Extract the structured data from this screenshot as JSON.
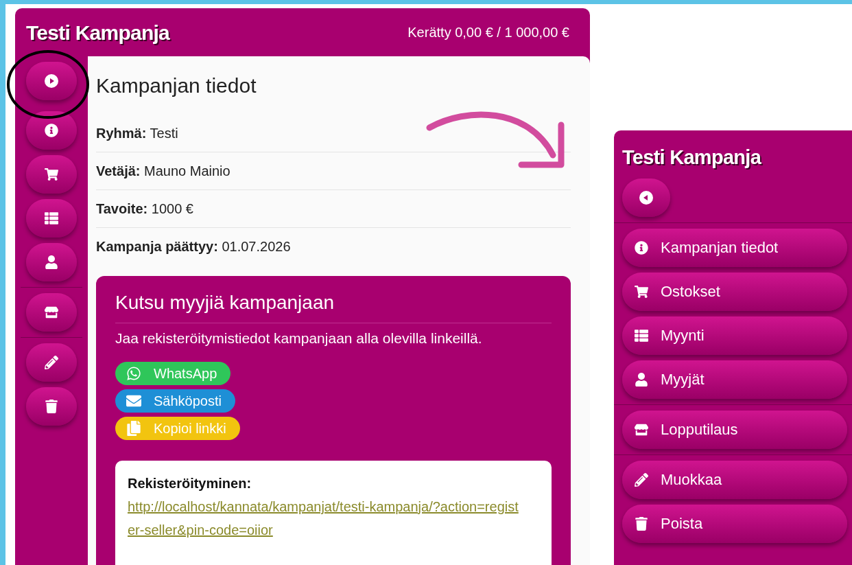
{
  "collapsed_view": {
    "title": "Testi Kampanja",
    "collected": "Kerätty 0,00 € / 1 000,00 €",
    "nav_groups": [
      [
        {
          "kind": "expand"
        }
      ],
      [
        {
          "kind": "info"
        },
        {
          "kind": "cart"
        },
        {
          "kind": "list"
        },
        {
          "kind": "user"
        }
      ],
      [
        {
          "kind": "store"
        }
      ],
      [
        {
          "kind": "edit"
        },
        {
          "kind": "delete"
        }
      ]
    ],
    "details": {
      "heading": "Kampanjan tiedot",
      "rows": [
        {
          "label": "Ryhmä:",
          "value": "Testi"
        },
        {
          "label": "Vetäjä:",
          "value": "Mauno Mainio"
        },
        {
          "label": "Tavoite:",
          "value": "1000 €"
        },
        {
          "label": "Kampanja päättyy:",
          "value": "01.07.2026"
        }
      ]
    },
    "invite": {
      "heading": "Kutsu myyjiä kampanjaan",
      "text": "Jaa rekisteröitymistiedot kampanjaan alla olevilla linkeillä.",
      "share_buttons": [
        {
          "kind": "whatsapp",
          "label": "WhatsApp"
        },
        {
          "kind": "email",
          "label": "Sähköposti"
        },
        {
          "kind": "copy",
          "label": "Kopioi linkki"
        }
      ],
      "link": {
        "label": "Rekisteröityminen:",
        "url": "http://localhost/kannata/kampanjat/testi-kampanja/?action=register-seller&pin-code=oiior"
      }
    }
  },
  "expanded_view": {
    "title": "Testi Kampanja",
    "nav_groups": [
      [
        {
          "kind": "collapse"
        }
      ],
      [
        {
          "kind": "info",
          "label": "Kampanjan tiedot"
        },
        {
          "kind": "cart",
          "label": "Ostokset"
        },
        {
          "kind": "list",
          "label": "Myynti"
        },
        {
          "kind": "user",
          "label": "Myyjät"
        }
      ],
      [
        {
          "kind": "store",
          "label": "Lopputilaus"
        }
      ],
      [
        {
          "kind": "edit",
          "label": "Muokkaa"
        },
        {
          "kind": "delete",
          "label": "Poista"
        }
      ]
    ]
  }
}
